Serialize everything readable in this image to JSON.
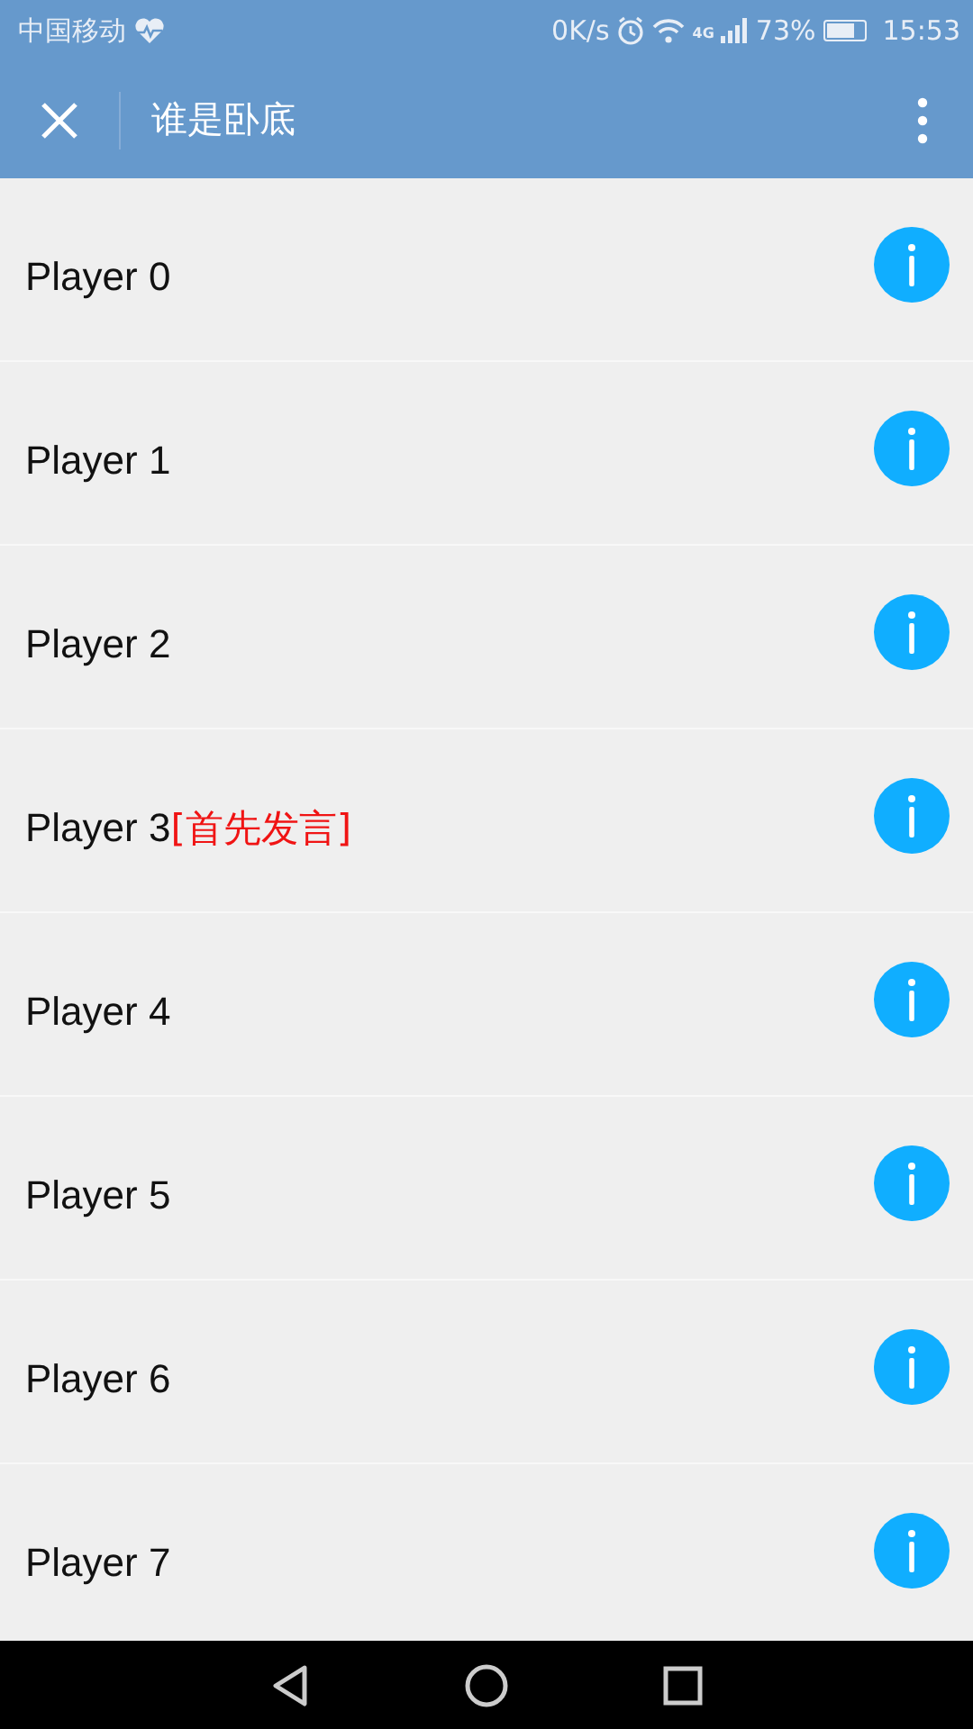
{
  "status_bar": {
    "carrier": "中国移动",
    "speed": "0K/s",
    "network": "4G",
    "battery": "73%",
    "time": "15:53"
  },
  "header": {
    "title": "谁是卧底"
  },
  "players": [
    {
      "name": "Player 0"
    },
    {
      "name": "Player 1"
    },
    {
      "name": "Player 2"
    },
    {
      "name": "Player 3",
      "tag": "[首先发言]"
    },
    {
      "name": "Player 4"
    },
    {
      "name": "Player 5"
    },
    {
      "name": "Player 6"
    },
    {
      "name": "Player 7"
    }
  ]
}
